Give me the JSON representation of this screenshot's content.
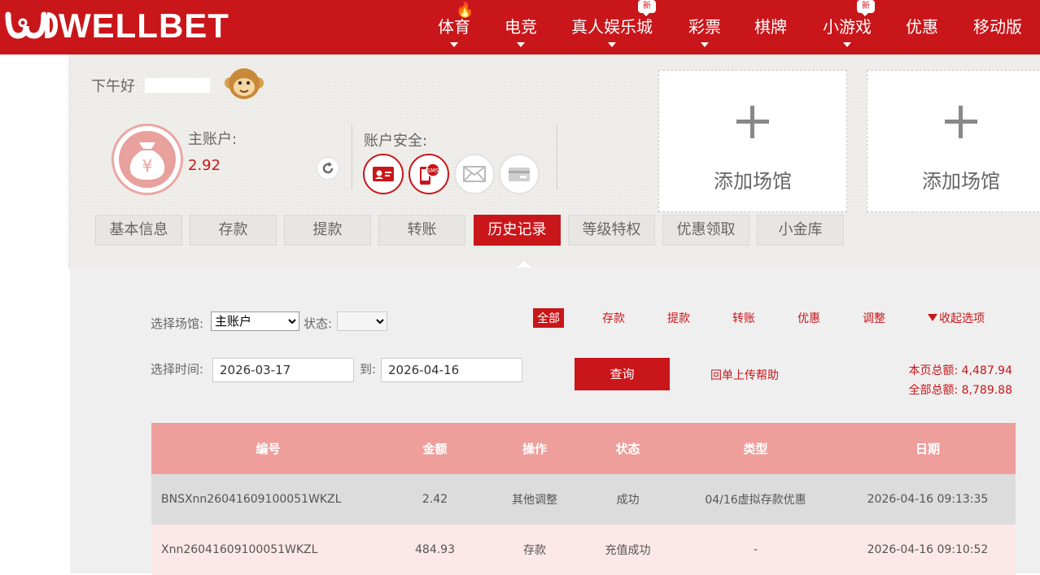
{
  "brand": {
    "logo_text": "WELLBET",
    "primary_color": "#c9161a"
  },
  "nav": {
    "items": [
      {
        "label": "体育",
        "flame": true
      },
      {
        "label": "电竞"
      },
      {
        "label": "真人娱乐城",
        "badge": "新"
      },
      {
        "label": "彩票"
      },
      {
        "label": "棋牌"
      },
      {
        "label": "小游戏",
        "badge": "新"
      },
      {
        "label": "优惠"
      },
      {
        "label": "移动版"
      }
    ]
  },
  "account": {
    "greeting": "下午好",
    "main_account_label": "主账户:",
    "main_account_value": "2.92",
    "security_label": "账户安全:",
    "security_icons": [
      {
        "name": "id-card-icon",
        "status": "verified"
      },
      {
        "name": "sms-phone-icon",
        "status": "verified",
        "text": "SMS"
      },
      {
        "name": "email-icon",
        "status": "unverified"
      },
      {
        "name": "bank-card-icon",
        "status": "unverified"
      }
    ],
    "yen_symbol": "¥"
  },
  "venues": [
    {
      "label": "添加场馆"
    },
    {
      "label": "添加场馆"
    }
  ],
  "tabs": [
    {
      "label": "基本信息"
    },
    {
      "label": "存款"
    },
    {
      "label": "提款"
    },
    {
      "label": "转账"
    },
    {
      "label": "历史记录",
      "active": true
    },
    {
      "label": "等级特权"
    },
    {
      "label": "优惠领取"
    },
    {
      "label": "小金库"
    }
  ],
  "filters": {
    "venue_label": "选择场馆:",
    "venue_value": "主账户",
    "status_label": "状态:",
    "status_value": "",
    "time_label": "选择时间:",
    "date_from": "2026-03-17",
    "to_label": "到:",
    "date_to": "2026-04-16",
    "types": [
      {
        "label": "全部",
        "active": true
      },
      {
        "label": "存款"
      },
      {
        "label": "提款"
      },
      {
        "label": "转账"
      },
      {
        "label": "优惠"
      },
      {
        "label": "调整"
      }
    ],
    "collapse_label": "收起选项",
    "query_button": "查询",
    "help_link": "回单上传帮助",
    "page_total": "本页总额: 4,487.94",
    "all_total": "全部总额: 8,789.88"
  },
  "table": {
    "columns": [
      "编号",
      "金额",
      "操作",
      "状态",
      "类型",
      "日期"
    ],
    "rows": [
      [
        "BNSXnn26041609100051WKZL",
        "2.42",
        "其他调整",
        "成功",
        "04/16虚拟存款优惠",
        "2026-04-16 09:13:35"
      ],
      [
        "Xnn26041609100051WKZL",
        "484.93",
        "存款",
        "充值成功",
        "-",
        "2026-04-16 09:10:52"
      ]
    ]
  }
}
